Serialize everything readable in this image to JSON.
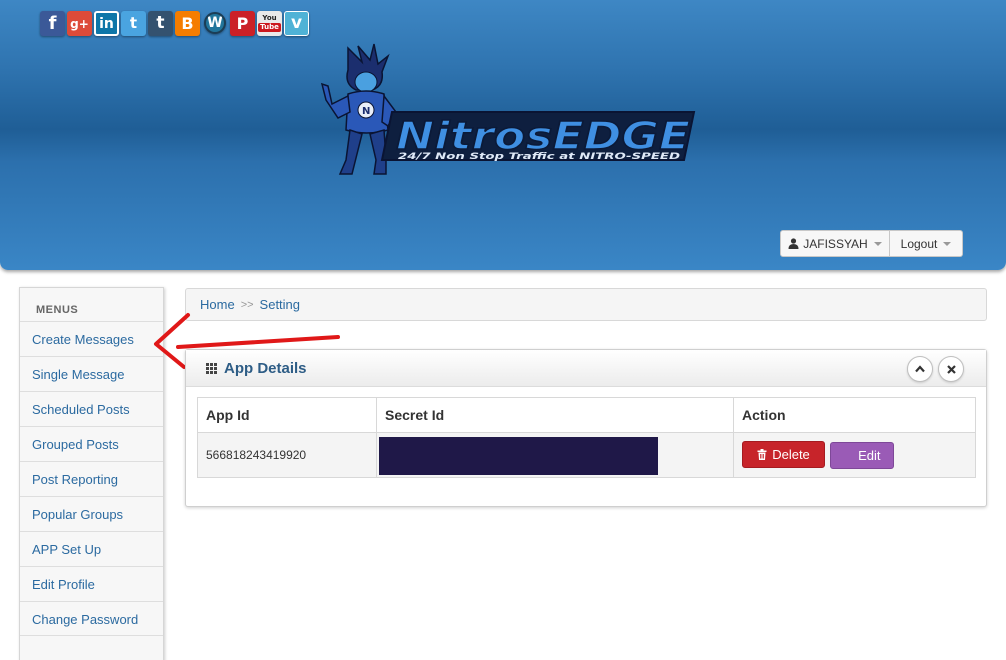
{
  "header": {
    "social_icons": [
      {
        "name": "facebook-icon",
        "glyph": "f",
        "cls": "fb"
      },
      {
        "name": "google-plus-icon",
        "glyph": "g+",
        "cls": "gp"
      },
      {
        "name": "linkedin-icon",
        "glyph": "in",
        "cls": "li"
      },
      {
        "name": "twitter-icon",
        "glyph": "t",
        "cls": "tw"
      },
      {
        "name": "tumblr-icon",
        "glyph": "t",
        "cls": "tu"
      },
      {
        "name": "blogger-icon",
        "glyph": "B",
        "cls": "bl"
      },
      {
        "name": "wordpress-icon",
        "glyph": "W",
        "cls": "wp"
      },
      {
        "name": "pinterest-icon",
        "glyph": "P",
        "cls": "pi"
      },
      {
        "name": "youtube-icon",
        "glyph": "You Tube",
        "cls": "yt"
      },
      {
        "name": "vimeo-icon",
        "glyph": "v",
        "cls": "vi"
      }
    ],
    "logo_text": "NitrosEDGE",
    "logo_tagline": "24/7 Non Stop Traffic at NITRO-SPEED",
    "user_label": "JAFISSYAH",
    "logout_label": "Logout"
  },
  "sidebar": {
    "title": "MENUS",
    "items": [
      {
        "label": "Create Messages"
      },
      {
        "label": "Single Message"
      },
      {
        "label": "Scheduled Posts"
      },
      {
        "label": "Grouped Posts"
      },
      {
        "label": "Post Reporting"
      },
      {
        "label": "Popular Groups"
      },
      {
        "label": "APP Set Up"
      },
      {
        "label": "Edit Profile"
      },
      {
        "label": "Change Password"
      }
    ]
  },
  "breadcrumb": {
    "home": "Home",
    "separator": ">>",
    "current": "Setting"
  },
  "panel": {
    "title": "App Details",
    "columns": [
      "App Id",
      "Secret Id",
      "Action"
    ],
    "rows": [
      {
        "app_id": "566818243419920"
      }
    ],
    "delete_label": "Delete",
    "edit_label": "Edit"
  },
  "colors": {
    "header_blue": "#2f74b0",
    "link_blue": "#2b6aa0",
    "delete_red": "#c7242a",
    "edit_purple": "#9a5bb6",
    "secret_mask": "#1f1848"
  }
}
